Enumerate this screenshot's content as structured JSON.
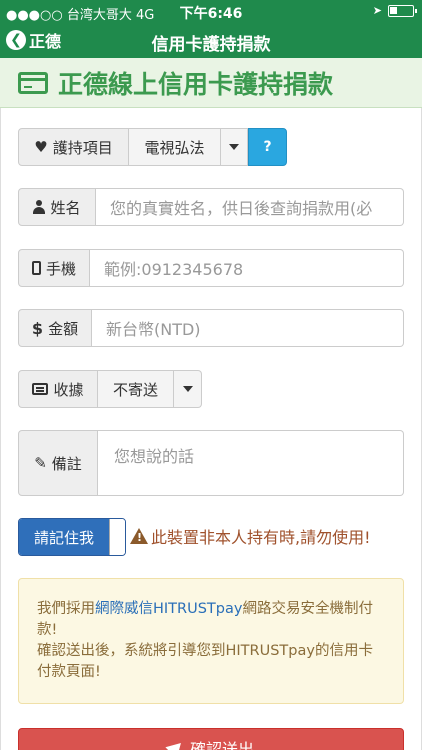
{
  "status_bar": {
    "carrier": "●●●○○ 台湾大哥大  4G",
    "time": "下午6:46"
  },
  "nav": {
    "back_label": "正德",
    "title": "信用卡護持捐款"
  },
  "header": {
    "title": "正德線上信用卡護持捐款"
  },
  "form": {
    "item": {
      "label": "護持項目",
      "value": "電視弘法",
      "help": "?"
    },
    "name": {
      "label": "姓名",
      "placeholder": "您的真實姓名，供日後查詢捐款用(必"
    },
    "phone": {
      "label": "手機",
      "placeholder": "範例:0912345678"
    },
    "amount": {
      "label": "金額",
      "placeholder": "新台幣(NTD)"
    },
    "receipt": {
      "label": "收據",
      "value": "不寄送"
    },
    "note": {
      "label": "備註",
      "placeholder": "您想說的話"
    },
    "remember": {
      "label": "請記住我"
    },
    "warning": "此裝置非本人持有時,請勿使用!"
  },
  "notice": {
    "part1": "我們採用",
    "link": "網際威信HITRUSTpay",
    "part2": "網路交易安全機制付款!",
    "line2": "確認送出後，系統將引導您到HITRUSTpay的信用卡付款頁面!"
  },
  "submit_label": "確認送出",
  "colors": {
    "primary_green": "#1f8a4c",
    "header_green": "#3c9a4f",
    "toggle_blue": "#2f6fba",
    "help_blue": "#2aa7e0",
    "danger_red": "#d9534f",
    "notice_bg": "#fcf8e3"
  }
}
